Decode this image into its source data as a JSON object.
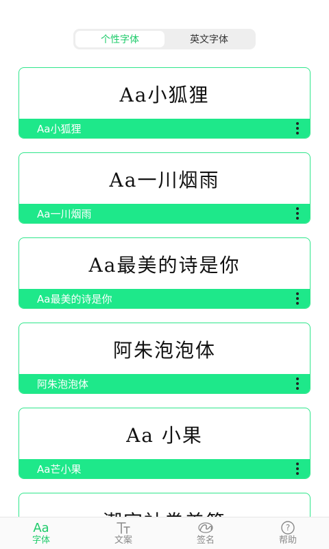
{
  "tabs": {
    "personal": "个性字体",
    "english": "英文字体"
  },
  "fonts": [
    {
      "preview": "Aa小狐狸",
      "name": "Aa小狐狸"
    },
    {
      "preview": "Aa一川烟雨",
      "name": "Aa一川烟雨"
    },
    {
      "preview": "Aa最美的诗是你",
      "name": "Aa最美的诗是你"
    },
    {
      "preview": "阿朱泡泡体",
      "name": "阿朱泡泡体"
    },
    {
      "preview": "Aa 小果",
      "name": "Aa芒小果"
    },
    {
      "preview": "潮字社卷美简"
    }
  ],
  "nav": {
    "font": {
      "icon": "Aa",
      "label": "字体"
    },
    "text": {
      "label": "文案"
    },
    "sign": {
      "label": "签名"
    },
    "help": {
      "icon": "?",
      "label": "帮助"
    }
  },
  "colors": {
    "accent": "#1ee88a",
    "active_text": "#1ecb6a"
  }
}
